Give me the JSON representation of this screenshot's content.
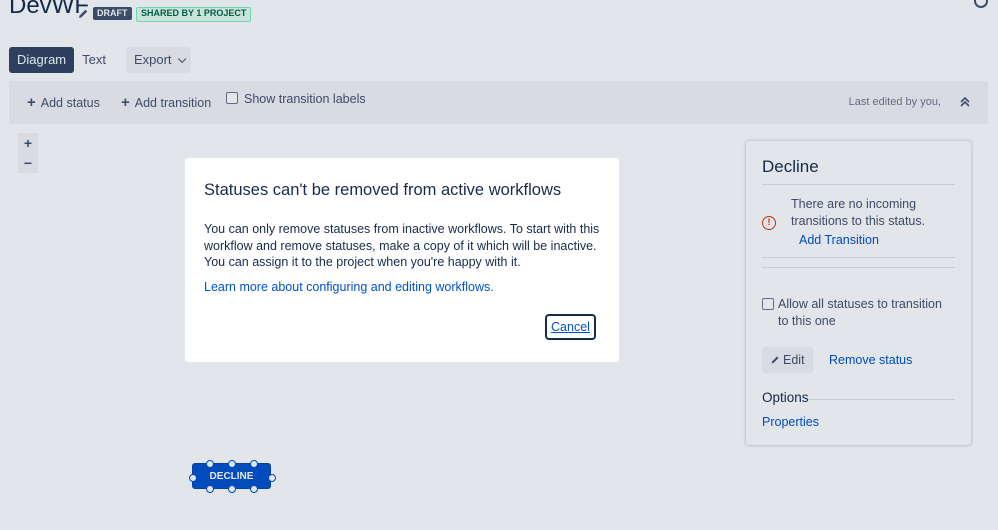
{
  "header": {
    "title": "DevWF",
    "edit_icon": "pencil-icon",
    "lozenge_draft": "DRAFT",
    "lozenge_shared": "SHARED BY 1 PROJECT"
  },
  "tabs": [
    {
      "label": "Diagram",
      "active": true
    },
    {
      "label": "Text",
      "active": false
    },
    {
      "label": "Export",
      "active": false
    }
  ],
  "toolbar": {
    "add_status": "Add status",
    "add_transition": "Add transition",
    "show_transition_labels": "Show transition labels",
    "last_edited": "Last edited by you,"
  },
  "zoom": {
    "in": "+",
    "out": "−"
  },
  "diagram": {
    "node_label": "DECLINE"
  },
  "panel": {
    "title": "Decline",
    "warning_text": "There are no incoming transitions to this status.",
    "add_transition_link": "Add Transition",
    "allow_all_label": "Allow all statuses to transition to this one",
    "edit_button": "Edit",
    "remove_status_link": "Remove status",
    "options_heading": "Options",
    "properties_link": "Properties"
  },
  "modal": {
    "title": "Statuses can't be removed from active workflows",
    "body": "You can only remove statuses from inactive workflows. To start with this workflow and remove statuses, make a copy of it which will be inactive. You can assign it to the project when you're happy with it.",
    "learn_more_link": "Learn more about configuring and editing workflows.",
    "cancel_button": "Cancel"
  },
  "colors": {
    "primary": "#0052cc",
    "text": "#172b4d",
    "subtle_text": "#42526e",
    "warning": "#de350b",
    "overlay": "#091e42"
  }
}
